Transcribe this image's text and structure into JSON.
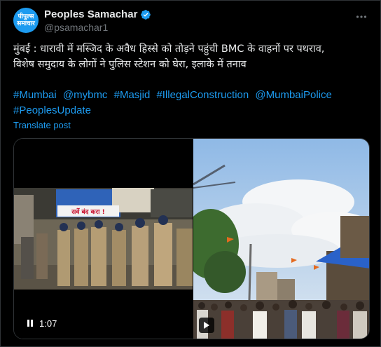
{
  "account": {
    "avatar_text": "पीपुल्स\nसमाचार",
    "name": "Peoples Samachar",
    "handle": "@psamachar1"
  },
  "post": {
    "text_line1": "मुंबई : धारावी में मस्जिद के अवैध हिस्से को तोड़ने पहुंची BMC  के वाहनों पर पथराव,",
    "text_line2": "विशेष समुदाय के लोगों ने पुलिस स्टेशन को घेरा, इलाके में तनाव",
    "hashtags": [
      "#Mumbai",
      "@mybmc",
      "#Masjid",
      "#IllegalConstruction",
      "@MumbaiPolice",
      "#PeoplesUpdate"
    ],
    "translate_label": "Translate post"
  },
  "media": {
    "video_time": "1:07",
    "banner_text": "सर्वे बंद करा !"
  },
  "colors": {
    "accent": "#1d9bf0",
    "text": "#e7e9ea",
    "muted": "#71767b",
    "background": "#000000"
  },
  "icons": {
    "verified": "verified-badge-icon",
    "more": "more-options-icon",
    "pause": "pause-icon",
    "play": "play-icon"
  }
}
